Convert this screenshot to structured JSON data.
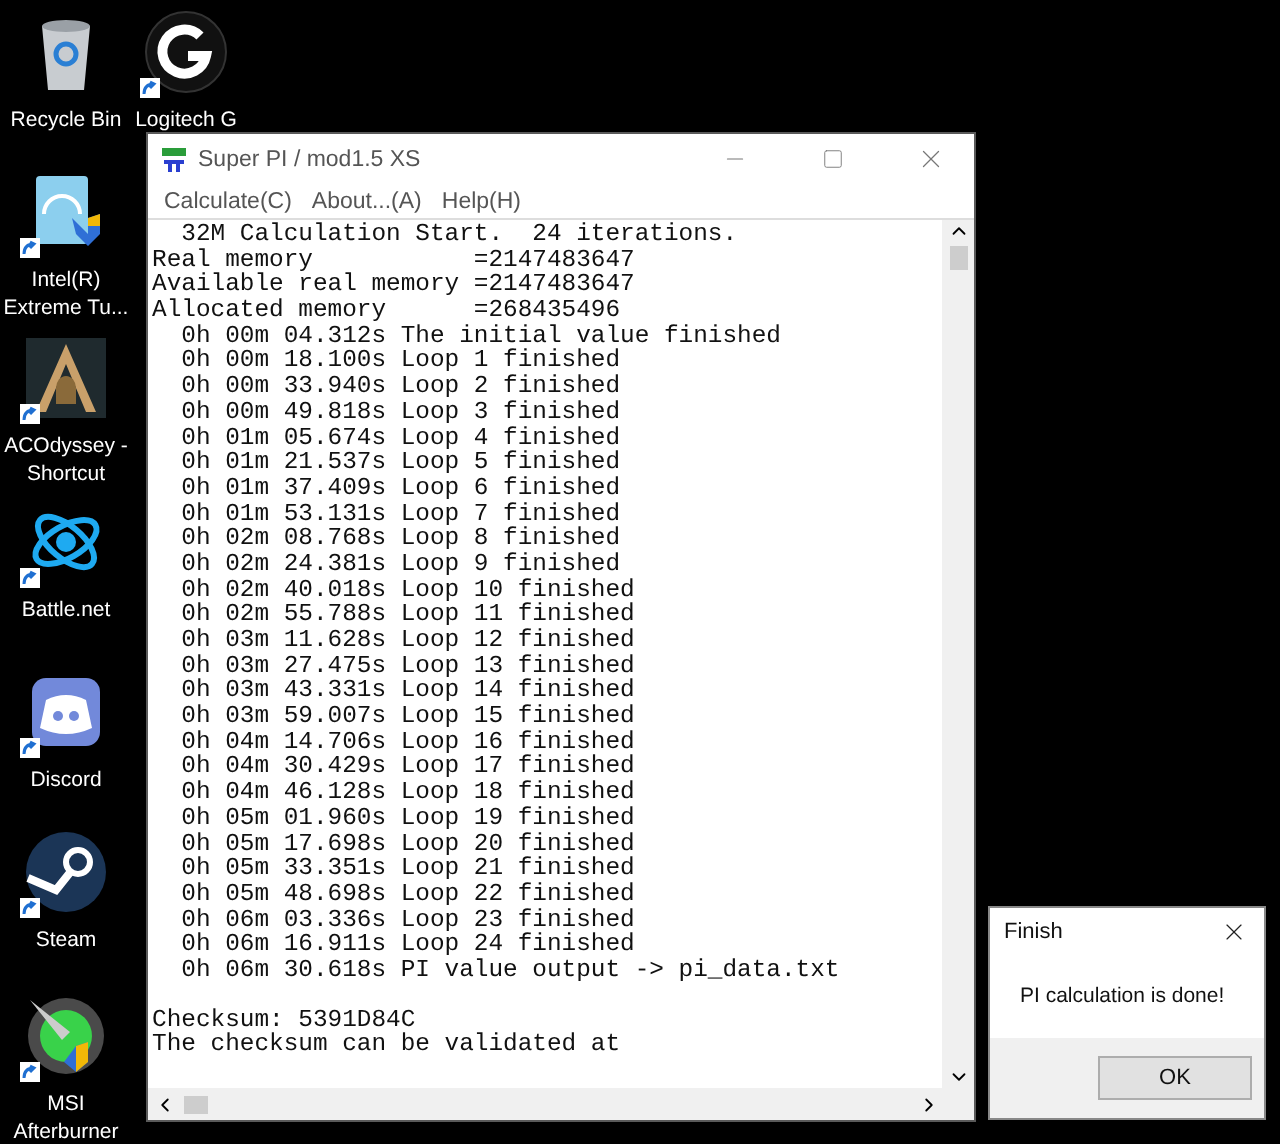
{
  "desktop_icons": [
    {
      "label": "Recycle Bin",
      "kind": "bin",
      "shortcut": false
    },
    {
      "label": "Logitech G",
      "kind": "ring",
      "shortcut": true
    },
    {
      "label": "Intel(R) Extreme Tu...",
      "kind": "gauge",
      "shortcut": true
    },
    {
      "label": "ACOdyssey - Shortcut",
      "kind": "helmet",
      "shortcut": true
    },
    {
      "label": "Battle.net",
      "kind": "swirl",
      "shortcut": true
    },
    {
      "label": "Discord",
      "kind": "chat",
      "shortcut": true
    },
    {
      "label": "Steam",
      "kind": "piston",
      "shortcut": true
    },
    {
      "label": "MSI Afterburner",
      "kind": "orb",
      "shortcut": true
    }
  ],
  "window": {
    "title": "Super PI / mod1.5 XS",
    "menu": [
      "Calculate(C)",
      "About...(A)",
      "Help(H)"
    ],
    "output_lines": [
      "  32M Calculation Start.  24 iterations.",
      "Real memory           =2147483647",
      "Available real memory =2147483647",
      "Allocated memory      =268435496",
      "  0h 00m 04.312s The initial value finished",
      "  0h 00m 18.100s Loop 1 finished",
      "  0h 00m 33.940s Loop 2 finished",
      "  0h 00m 49.818s Loop 3 finished",
      "  0h 01m 05.674s Loop 4 finished",
      "  0h 01m 21.537s Loop 5 finished",
      "  0h 01m 37.409s Loop 6 finished",
      "  0h 01m 53.131s Loop 7 finished",
      "  0h 02m 08.768s Loop 8 finished",
      "  0h 02m 24.381s Loop 9 finished",
      "  0h 02m 40.018s Loop 10 finished",
      "  0h 02m 55.788s Loop 11 finished",
      "  0h 03m 11.628s Loop 12 finished",
      "  0h 03m 27.475s Loop 13 finished",
      "  0h 03m 43.331s Loop 14 finished",
      "  0h 03m 59.007s Loop 15 finished",
      "  0h 04m 14.706s Loop 16 finished",
      "  0h 04m 30.429s Loop 17 finished",
      "  0h 04m 46.128s Loop 18 finished",
      "  0h 05m 01.960s Loop 19 finished",
      "  0h 05m 17.698s Loop 20 finished",
      "  0h 05m 33.351s Loop 21 finished",
      "  0h 05m 48.698s Loop 22 finished",
      "  0h 06m 03.336s Loop 23 finished",
      "  0h 06m 16.911s Loop 24 finished",
      "  0h 06m 30.618s PI value output -> pi_data.txt"
    ],
    "footer_lines": [
      "Checksum: 5391D84C",
      "The checksum can be validated at"
    ]
  },
  "dialog": {
    "title": "Finish",
    "message": "PI calculation is done!",
    "button": "OK"
  }
}
